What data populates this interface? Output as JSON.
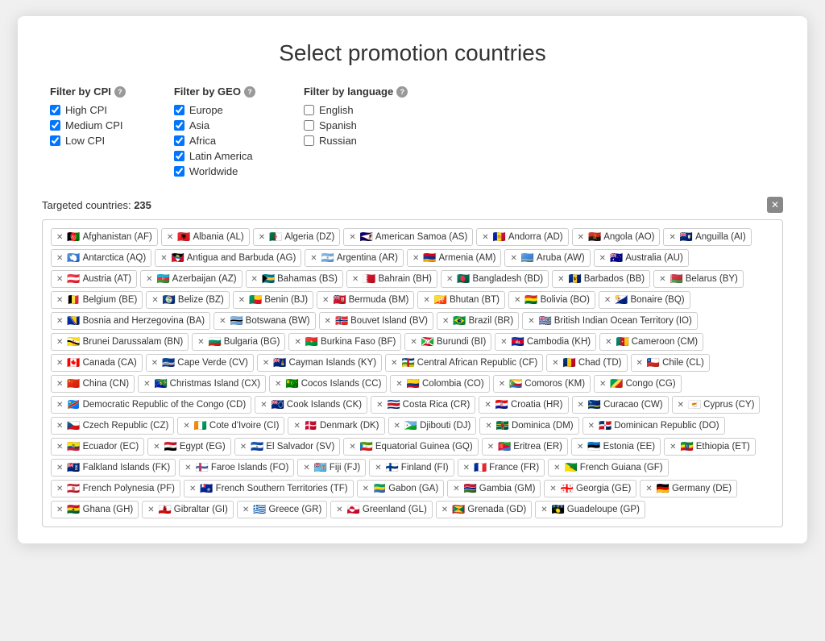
{
  "title": "Select promotion countries",
  "filters": {
    "cpi": {
      "label": "Filter by CPI",
      "options": [
        {
          "label": "High CPI",
          "checked": true
        },
        {
          "label": "Medium CPI",
          "checked": true
        },
        {
          "label": "Low CPI",
          "checked": true
        }
      ]
    },
    "geo": {
      "label": "Filter by GEO",
      "options": [
        {
          "label": "Europe",
          "checked": true
        },
        {
          "label": "Asia",
          "checked": true
        },
        {
          "label": "Africa",
          "checked": true
        },
        {
          "label": "Latin America",
          "checked": true
        },
        {
          "label": "Worldwide",
          "checked": true
        }
      ]
    },
    "language": {
      "label": "Filter by language",
      "options": [
        {
          "label": "English",
          "checked": false
        },
        {
          "label": "Spanish",
          "checked": false
        },
        {
          "label": "Russian",
          "checked": false
        }
      ]
    }
  },
  "targeted": {
    "label": "Targeted countries:",
    "count": "235"
  },
  "countries": [
    {
      "name": "Afghanistan (AF)",
      "flag": "🇦🇫"
    },
    {
      "name": "Albania (AL)",
      "flag": "🇦🇱"
    },
    {
      "name": "Algeria (DZ)",
      "flag": "🇩🇿"
    },
    {
      "name": "American Samoa (AS)",
      "flag": "🇦🇸"
    },
    {
      "name": "Andorra (AD)",
      "flag": "🇦🇩"
    },
    {
      "name": "Angola (AO)",
      "flag": "🇦🇴"
    },
    {
      "name": "Anguilla (AI)",
      "flag": "🇦🇮"
    },
    {
      "name": "Antarctica (AQ)",
      "flag": "🇦🇶"
    },
    {
      "name": "Antigua and Barbuda (AG)",
      "flag": "🇦🇬"
    },
    {
      "name": "Argentina (AR)",
      "flag": "🇦🇷"
    },
    {
      "name": "Armenia (AM)",
      "flag": "🇦🇲"
    },
    {
      "name": "Aruba (AW)",
      "flag": "🇦🇼"
    },
    {
      "name": "Australia (AU)",
      "flag": "🇦🇺"
    },
    {
      "name": "Austria (AT)",
      "flag": "🇦🇹"
    },
    {
      "name": "Azerbaijan (AZ)",
      "flag": "🇦🇿"
    },
    {
      "name": "Bahamas (BS)",
      "flag": "🇧🇸"
    },
    {
      "name": "Bahrain (BH)",
      "flag": "🇧🇭"
    },
    {
      "name": "Bangladesh (BD)",
      "flag": "🇧🇩"
    },
    {
      "name": "Barbados (BB)",
      "flag": "🇧🇧"
    },
    {
      "name": "Belarus (BY)",
      "flag": "🇧🇾"
    },
    {
      "name": "Belgium (BE)",
      "flag": "🇧🇪"
    },
    {
      "name": "Belize (BZ)",
      "flag": "🇧🇿"
    },
    {
      "name": "Benin (BJ)",
      "flag": "🇧🇯"
    },
    {
      "name": "Bermuda (BM)",
      "flag": "🇧🇲"
    },
    {
      "name": "Bhutan (BT)",
      "flag": "🇧🇹"
    },
    {
      "name": "Bolivia (BO)",
      "flag": "🇧🇴"
    },
    {
      "name": "Bonaire (BQ)",
      "flag": "🇧🇶"
    },
    {
      "name": "Bosnia and Herzegovina (BA)",
      "flag": "🇧🇦"
    },
    {
      "name": "Botswana (BW)",
      "flag": "🇧🇼"
    },
    {
      "name": "Bouvet Island (BV)",
      "flag": "🇧🇻"
    },
    {
      "name": "Brazil (BR)",
      "flag": "🇧🇷"
    },
    {
      "name": "British Indian Ocean Territory (IO)",
      "flag": "🇮🇴"
    },
    {
      "name": "Brunei Darussalam (BN)",
      "flag": "🇧🇳"
    },
    {
      "name": "Bulgaria (BG)",
      "flag": "🇧🇬"
    },
    {
      "name": "Burkina Faso (BF)",
      "flag": "🇧🇫"
    },
    {
      "name": "Burundi (BI)",
      "flag": "🇧🇮"
    },
    {
      "name": "Cambodia (KH)",
      "flag": "🇰🇭"
    },
    {
      "name": "Cameroon (CM)",
      "flag": "🇨🇲"
    },
    {
      "name": "Canada (CA)",
      "flag": "🇨🇦"
    },
    {
      "name": "Cape Verde (CV)",
      "flag": "🇨🇻"
    },
    {
      "name": "Cayman Islands (KY)",
      "flag": "🇰🇾"
    },
    {
      "name": "Central African Republic (CF)",
      "flag": "🇨🇫"
    },
    {
      "name": "Chad (TD)",
      "flag": "🇹🇩"
    },
    {
      "name": "Chile (CL)",
      "flag": "🇨🇱"
    },
    {
      "name": "China (CN)",
      "flag": "🇨🇳"
    },
    {
      "name": "Christmas Island (CX)",
      "flag": "🇨🇽"
    },
    {
      "name": "Cocos Islands (CC)",
      "flag": "🇨🇨"
    },
    {
      "name": "Colombia (CO)",
      "flag": "🇨🇴"
    },
    {
      "name": "Comoros (KM)",
      "flag": "🇰🇲"
    },
    {
      "name": "Congo (CG)",
      "flag": "🇨🇬"
    },
    {
      "name": "Democratic Republic of the Congo (CD)",
      "flag": "🇨🇩"
    },
    {
      "name": "Cook Islands (CK)",
      "flag": "🇨🇰"
    },
    {
      "name": "Costa Rica (CR)",
      "flag": "🇨🇷"
    },
    {
      "name": "Croatia (HR)",
      "flag": "🇭🇷"
    },
    {
      "name": "Curacao (CW)",
      "flag": "🇨🇼"
    },
    {
      "name": "Cyprus (CY)",
      "flag": "🇨🇾"
    },
    {
      "name": "Czech Republic (CZ)",
      "flag": "🇨🇿"
    },
    {
      "name": "Cote d'Ivoire (CI)",
      "flag": "🇨🇮"
    },
    {
      "name": "Denmark (DK)",
      "flag": "🇩🇰"
    },
    {
      "name": "Djibouti (DJ)",
      "flag": "🇩🇯"
    },
    {
      "name": "Dominica (DM)",
      "flag": "🇩🇲"
    },
    {
      "name": "Dominican Republic (DO)",
      "flag": "🇩🇴"
    },
    {
      "name": "Ecuador (EC)",
      "flag": "🇪🇨"
    },
    {
      "name": "Egypt (EG)",
      "flag": "🇪🇬"
    },
    {
      "name": "El Salvador (SV)",
      "flag": "🇸🇻"
    },
    {
      "name": "Equatorial Guinea (GQ)",
      "flag": "🇬🇶"
    },
    {
      "name": "Eritrea (ER)",
      "flag": "🇪🇷"
    },
    {
      "name": "Estonia (EE)",
      "flag": "🇪🇪"
    },
    {
      "name": "Ethiopia (ET)",
      "flag": "🇪🇹"
    },
    {
      "name": "Falkland Islands (FK)",
      "flag": "🇫🇰"
    },
    {
      "name": "Faroe Islands (FO)",
      "flag": "🇫🇴"
    },
    {
      "name": "Fiji (FJ)",
      "flag": "🇫🇯"
    },
    {
      "name": "Finland (FI)",
      "flag": "🇫🇮"
    },
    {
      "name": "France (FR)",
      "flag": "🇫🇷"
    },
    {
      "name": "French Guiana (GF)",
      "flag": "🇬🇫"
    },
    {
      "name": "French Polynesia (PF)",
      "flag": "🇵🇫"
    },
    {
      "name": "French Southern Territories (TF)",
      "flag": "🇹🇫"
    },
    {
      "name": "Gabon (GA)",
      "flag": "🇬🇦"
    },
    {
      "name": "Gambia (GM)",
      "flag": "🇬🇲"
    },
    {
      "name": "Georgia (GE)",
      "flag": "🇬🇪"
    },
    {
      "name": "Germany (DE)",
      "flag": "🇩🇪"
    },
    {
      "name": "Ghana (GH)",
      "flag": "🇬🇭"
    },
    {
      "name": "Gibraltar (GI)",
      "flag": "🇬🇮"
    },
    {
      "name": "Greece (GR)",
      "flag": "🇬🇷"
    },
    {
      "name": "Greenland (GL)",
      "flag": "🇬🇱"
    },
    {
      "name": "Grenada (GD)",
      "flag": "🇬🇩"
    },
    {
      "name": "Guadeloupe (GP)",
      "flag": "🇬🇵"
    }
  ]
}
